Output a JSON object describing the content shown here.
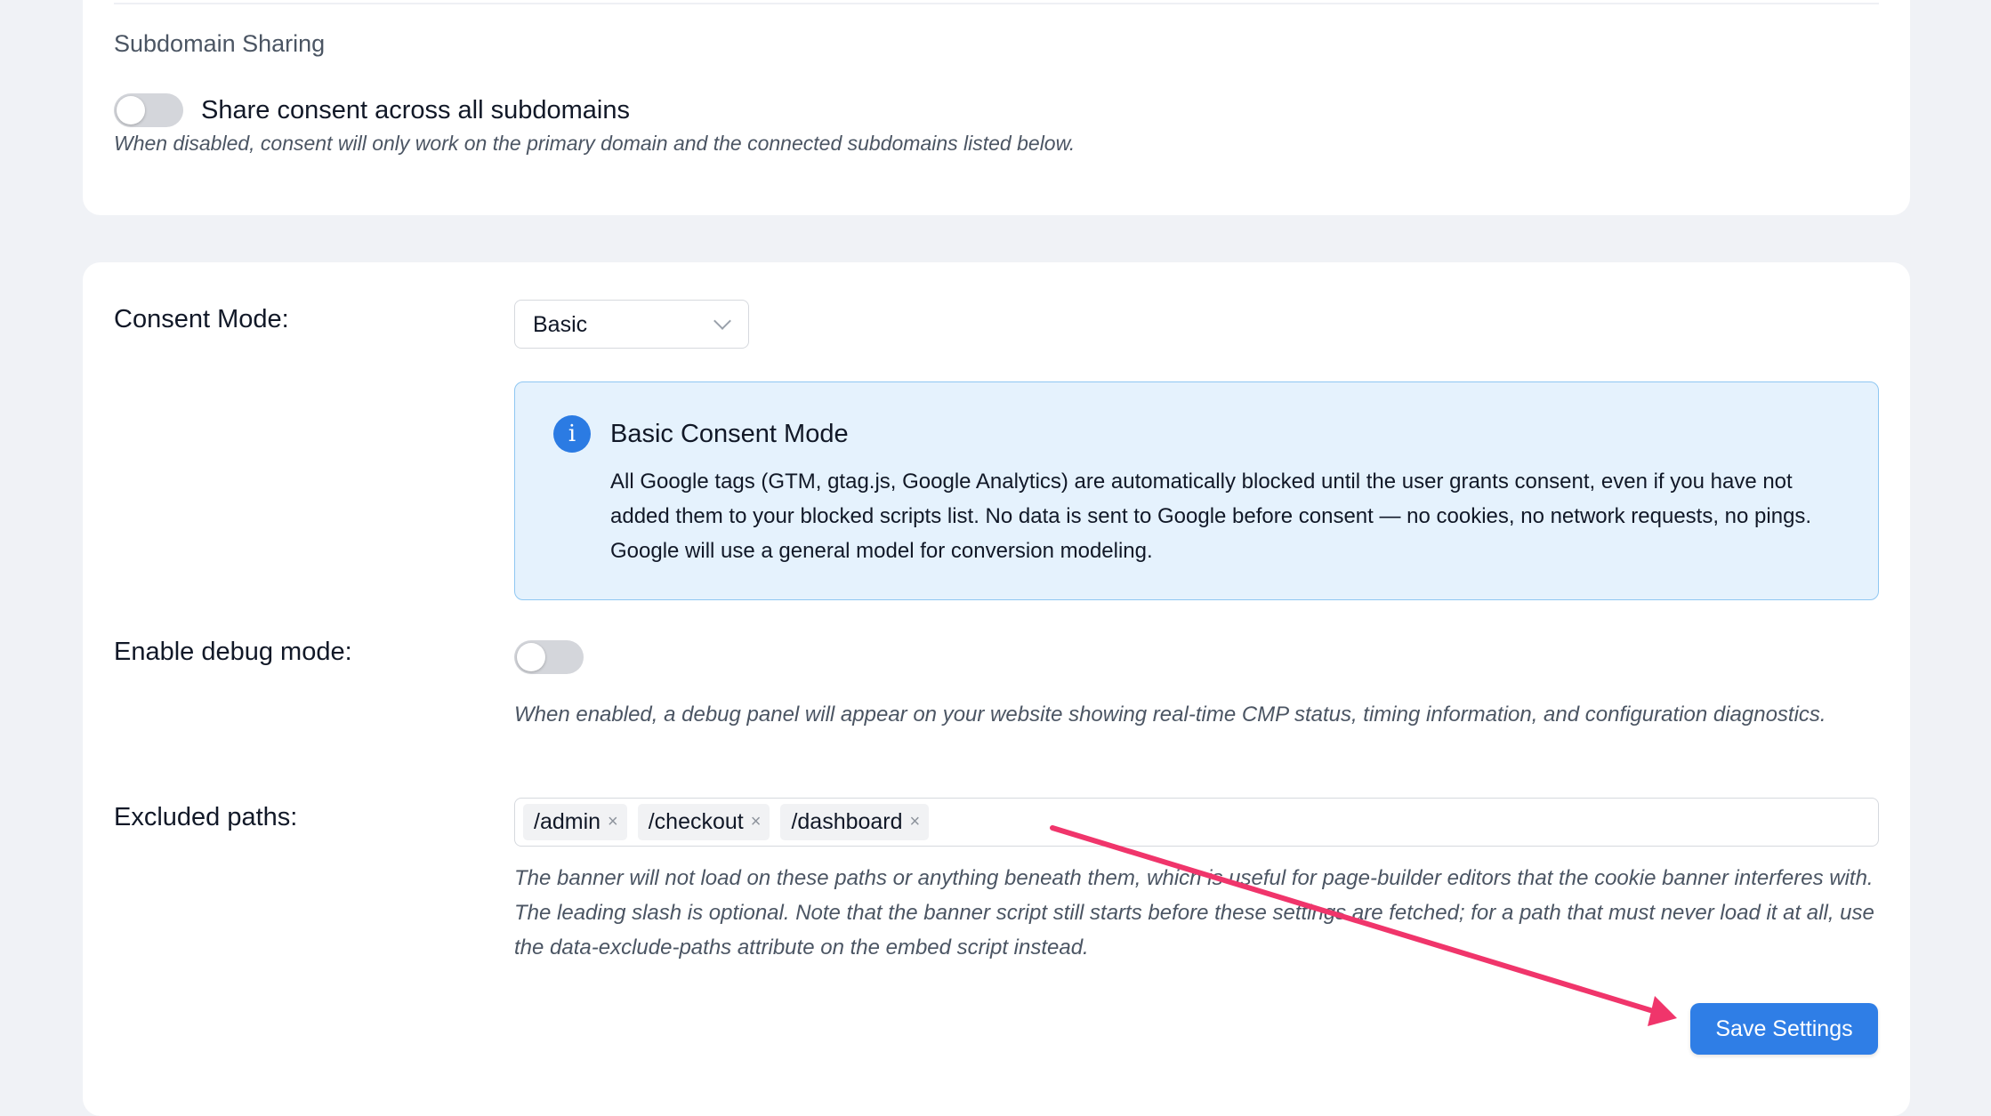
{
  "subdomain": {
    "title": "Subdomain Sharing",
    "toggle_label": "Share consent across all subdomains",
    "toggle_on": false,
    "help": "When disabled, consent will only work on the primary domain and the connected subdomains listed below."
  },
  "consent_mode": {
    "label": "Consent Mode:",
    "selected": "Basic",
    "info": {
      "icon": "info-icon",
      "title": "Basic Consent Mode",
      "body": "All Google tags (GTM, gtag.js, Google Analytics) are automatically blocked until the user grants consent, even if you have not added them to your blocked scripts list. No data is sent to Google before consent — no cookies, no network requests, no pings. Google will use a general model for conversion modeling."
    }
  },
  "debug": {
    "label": "Enable debug mode:",
    "toggle_on": false,
    "help": "When enabled, a debug panel will appear on your website showing real-time CMP status, timing information, and configuration diagnostics."
  },
  "excluded_paths": {
    "label": "Excluded paths:",
    "tags": [
      "/admin",
      "/checkout",
      "/dashboard"
    ],
    "remove_glyph": "×",
    "help": "The banner will not load on these paths or anything beneath them, which is useful for page-builder editors that the cookie banner interferes with. The leading slash is optional. Note that the banner script still starts before these settings are fetched; for a path that must never load it at all, use the data-exclude-paths attribute on the embed script instead."
  },
  "save_button": {
    "label": "Save Settings"
  },
  "colors": {
    "accent": "#2f7ee6",
    "annotation_arrow": "#f0356b",
    "info_background": "#e5f2fd",
    "info_border": "#8fc7f2"
  }
}
